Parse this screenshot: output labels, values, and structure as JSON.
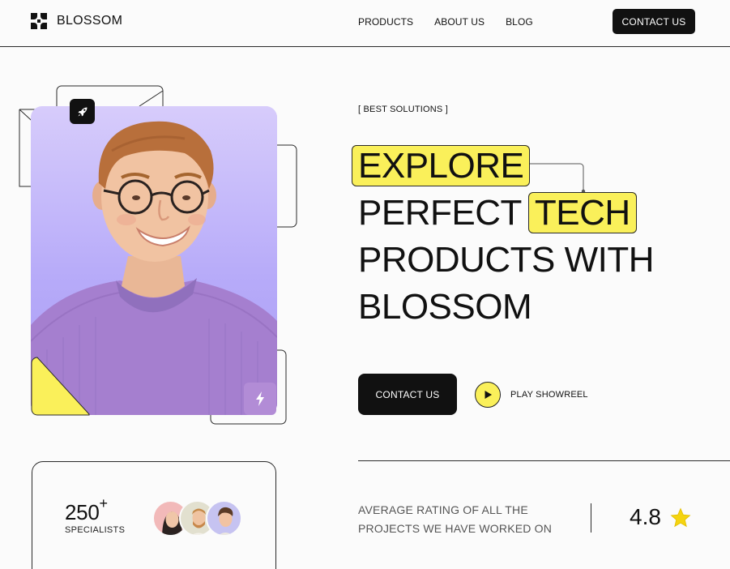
{
  "brand": {
    "name": "BLOSSOM"
  },
  "nav": {
    "items": [
      "PRODUCTS",
      "ABOUT US",
      "BLOG"
    ],
    "cta": "CONTACT US"
  },
  "hero": {
    "eyebrow": "[ BEST SOLUTIONS ]",
    "headline": {
      "line1": "EXPLORE",
      "line2_a": "PERFECT",
      "line2_b": "TECH",
      "line3": "PRODUCTS WITH",
      "line4": "BLOSSOM"
    },
    "primary_button": "CONTACT US",
    "secondary_button": "PLAY SHOWREEL"
  },
  "stats": {
    "specialists_count": "250",
    "specialists_suffix": "+",
    "specialists_label": "SPECIALISTS"
  },
  "rating": {
    "text_line1": "AVERAGE RATING OF ALL THE",
    "text_line2": "PROJECTS WE HAVE WORKED ON",
    "value": "4.8"
  },
  "colors": {
    "accent_yellow": "#faf05a",
    "dark": "#111111",
    "lavender": "#b7abf9"
  },
  "icons": [
    "logo-mark-icon",
    "rocket-icon",
    "bolt-icon",
    "play-icon",
    "star-icon"
  ]
}
